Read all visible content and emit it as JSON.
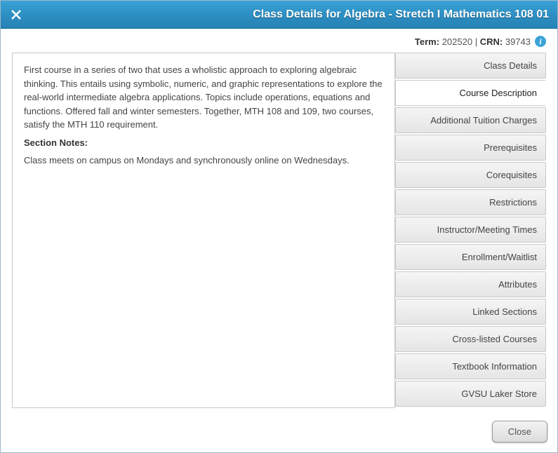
{
  "dialog": {
    "title": "Class Details for Algebra - Stretch I Mathematics 108 01"
  },
  "meta": {
    "term_label": "Term",
    "term_value": "202520",
    "crn_label": "CRN",
    "crn_value": "39743"
  },
  "tabs": [
    {
      "id": "class-details",
      "label": "Class Details"
    },
    {
      "id": "course-description",
      "label": "Course Description"
    },
    {
      "id": "additional-tuition",
      "label": "Additional Tuition Charges"
    },
    {
      "id": "prerequisites",
      "label": "Prerequisites"
    },
    {
      "id": "corequisites",
      "label": "Corequisites"
    },
    {
      "id": "restrictions",
      "label": "Restrictions"
    },
    {
      "id": "instructor-meeting",
      "label": "Instructor/Meeting Times"
    },
    {
      "id": "enrollment-waitlist",
      "label": "Enrollment/Waitlist"
    },
    {
      "id": "attributes",
      "label": "Attributes"
    },
    {
      "id": "linked-sections",
      "label": "Linked Sections"
    },
    {
      "id": "cross-listed",
      "label": "Cross-listed Courses"
    },
    {
      "id": "textbook-info",
      "label": "Textbook Information"
    },
    {
      "id": "laker-store",
      "label": "GVSU Laker Store"
    }
  ],
  "active_tab_index": 1,
  "content": {
    "description": "First course in a series of two that uses a wholistic approach to exploring algebraic thinking. This entails using symbolic, numeric, and graphic representations to explore the real-world intermediate algebra applications. Topics include operations, equations and functions. Offered fall and winter semesters. Together, MTH 108 and 109, two courses, satisfy the MTH 110 requirement.",
    "section_notes_label": "Section Notes:",
    "section_notes": "Class meets on campus on Mondays and synchronously online on Wednesdays."
  },
  "footer": {
    "close_label": "Close"
  }
}
